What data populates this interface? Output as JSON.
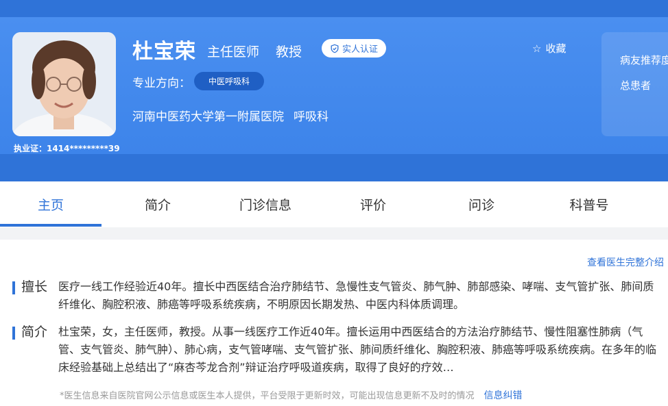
{
  "doctor": {
    "name": "杜宝荣",
    "titles": [
      "主任医师",
      "教授"
    ],
    "verify_label": "实人认证",
    "favorite_label": "收藏",
    "license": "执业证：1414*********39",
    "specialty_label": "专业方向：",
    "specialty_tag": "中医呼吸科",
    "hospital": "河南中医药大学第一附属医院",
    "department": "呼吸科"
  },
  "side_panel": {
    "line1": "病友推荐度",
    "line2": "总患者"
  },
  "tabs": [
    {
      "label": "主页",
      "active": true
    },
    {
      "label": "简介",
      "active": false
    },
    {
      "label": "门诊信息",
      "active": false
    },
    {
      "label": "评价",
      "active": false
    },
    {
      "label": "问诊",
      "active": false
    },
    {
      "label": "科普号",
      "active": false
    }
  ],
  "content": {
    "more_link": "查看医生完整介绍",
    "expertise_label": "擅长",
    "expertise_text": "医疗一线工作经验近40年。擅长中西医结合治疗肺结节、急慢性支气管炎、肺气肿、肺部感染、哮喘、支气管扩张、肺间质纤维化、胸腔积液、肺癌等呼吸系统疾病，不明原因长期发热、中医内科体质调理。",
    "intro_label": "简介",
    "intro_text": "杜宝荣，女，主任医师，教授。从事一线医疗工作近40年。擅长运用中西医结合的方法治疗肺结节、慢性阻塞性肺病（气管、支气管炎、肺气肿）、肺心病，支气管哮喘、支气管扩张、肺间质纤维化、胸腔积液、肺癌等呼吸系统疾病。在多年的临床经验基础上总结出了“麻杏芩龙合剂”辩证治疗呼吸道疾病，取得了良好的疗效…",
    "notice": "*医生信息来自医院官网公示信息或医生本人提供，平台受限于更新时效，可能出现信息更新不及时的情况",
    "fix_link": "信息纠错"
  },
  "colors": {
    "brand": "#2f73d8",
    "header_bg": "#3d84ea"
  }
}
